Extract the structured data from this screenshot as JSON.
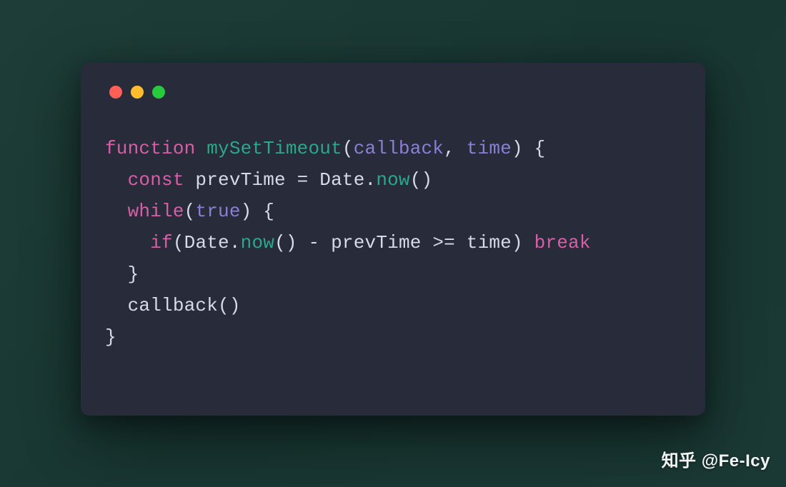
{
  "code": {
    "line1": {
      "kw_function": "function",
      "name": "mySetTimeout",
      "paren_open": "(",
      "param1": "callback",
      "comma": ", ",
      "param2": "time",
      "paren_close": ")",
      "brace_open": " {"
    },
    "line2": {
      "indent": "  ",
      "kw_const": "const",
      "var": " prevTime ",
      "eq": "=",
      "sp": " ",
      "cls": "Date",
      "dot": ".",
      "method": "now",
      "call": "()"
    },
    "line3": {
      "indent": "  ",
      "kw_while": "while",
      "paren_open": "(",
      "true": "true",
      "paren_close": ")",
      "brace_open": " {"
    },
    "line4": {
      "indent": "    ",
      "kw_if": "if",
      "paren_open": "(",
      "cls": "Date",
      "dot": ".",
      "method": "now",
      "call": "() ",
      "minus": "-",
      "prev": " prevTime ",
      "gte": ">=",
      "time": " time",
      "paren_close": ")",
      "sp": " ",
      "kw_break": "break"
    },
    "line5": {
      "indent": "  ",
      "brace_close": "}"
    },
    "line6": {
      "indent": "  ",
      "callback": "callback",
      "call": "()"
    },
    "line7": {
      "brace_close": "}"
    }
  },
  "watermark": "知乎 @Fe-Icy"
}
